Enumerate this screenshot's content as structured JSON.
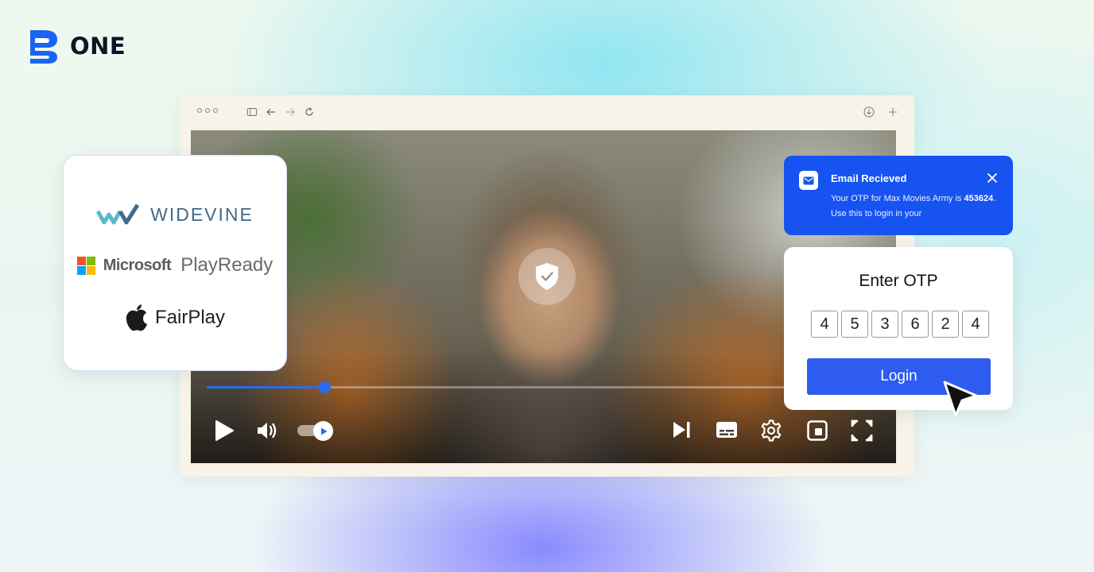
{
  "brand": {
    "name": "ONE",
    "color": "#1b63f5"
  },
  "browser": {
    "toolbar_icons": [
      "window-dots-icon",
      "sidebar-icon",
      "back-arrow-icon",
      "forward-arrow-icon",
      "reload-icon",
      "download-icon",
      "new-tab-icon"
    ]
  },
  "player": {
    "progress": 0.2,
    "accent": "#2a6cf6",
    "badge_icon": "shield-check-icon",
    "controls": [
      "play-icon",
      "volume-icon",
      "autoplay-toggle",
      "skip-next-icon",
      "captions-icon",
      "settings-gear-icon",
      "picture-in-picture-icon",
      "fullscreen-icon"
    ]
  },
  "drm": {
    "widevine": "WIDEVINE",
    "microsoft": "Microsoft",
    "playready": "PlayReady",
    "fairplay": "FairPlay"
  },
  "toast": {
    "title": "Email Recieved",
    "message_prefix": "Your OTP for Max Movies Army is",
    "code": "453624",
    "message_suffix": ". Use this to login in your",
    "background": "#1653f0"
  },
  "otp": {
    "title": "Enter OTP",
    "digits": [
      "4",
      "5",
      "3",
      "6",
      "2",
      "4"
    ],
    "login_label": "Login",
    "button_color": "#2e5cf0"
  }
}
